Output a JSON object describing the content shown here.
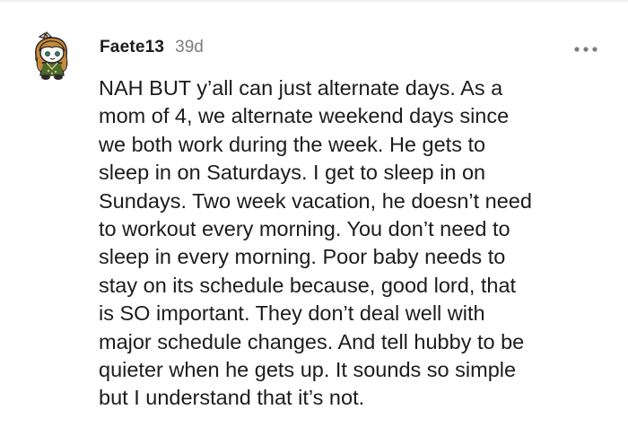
{
  "comment": {
    "username": "Faete13",
    "timestamp": "39d",
    "more_icon": "more-horizontal-icon",
    "avatar_icon": "snoo-avatar-icon",
    "body_lines": [
      "NAH BUT y’all can just alternate days. As a",
      "mom of 4, we alternate weekend days since",
      "we both work during the week. He gets to",
      "sleep in on Saturdays. I get to sleep in on",
      "Sundays. Two week vacation, he doesn’t need",
      "to workout every morning. You don’t need to",
      "sleep in every morning. Poor baby needs to",
      "stay on its schedule because, good lord, that",
      "is SO important. They don’t deal well with",
      "major schedule changes. And tell hubby to be",
      "quieter when he gets up. It sounds so simple",
      "but I understand that it’s not."
    ]
  },
  "colors": {
    "text": "#1c1c1c",
    "muted": "#7c7c7c",
    "avatar_hair": "#c98a3a",
    "avatar_shirt": "#4a6b2a",
    "avatar_eye": "#2a8a5a"
  }
}
